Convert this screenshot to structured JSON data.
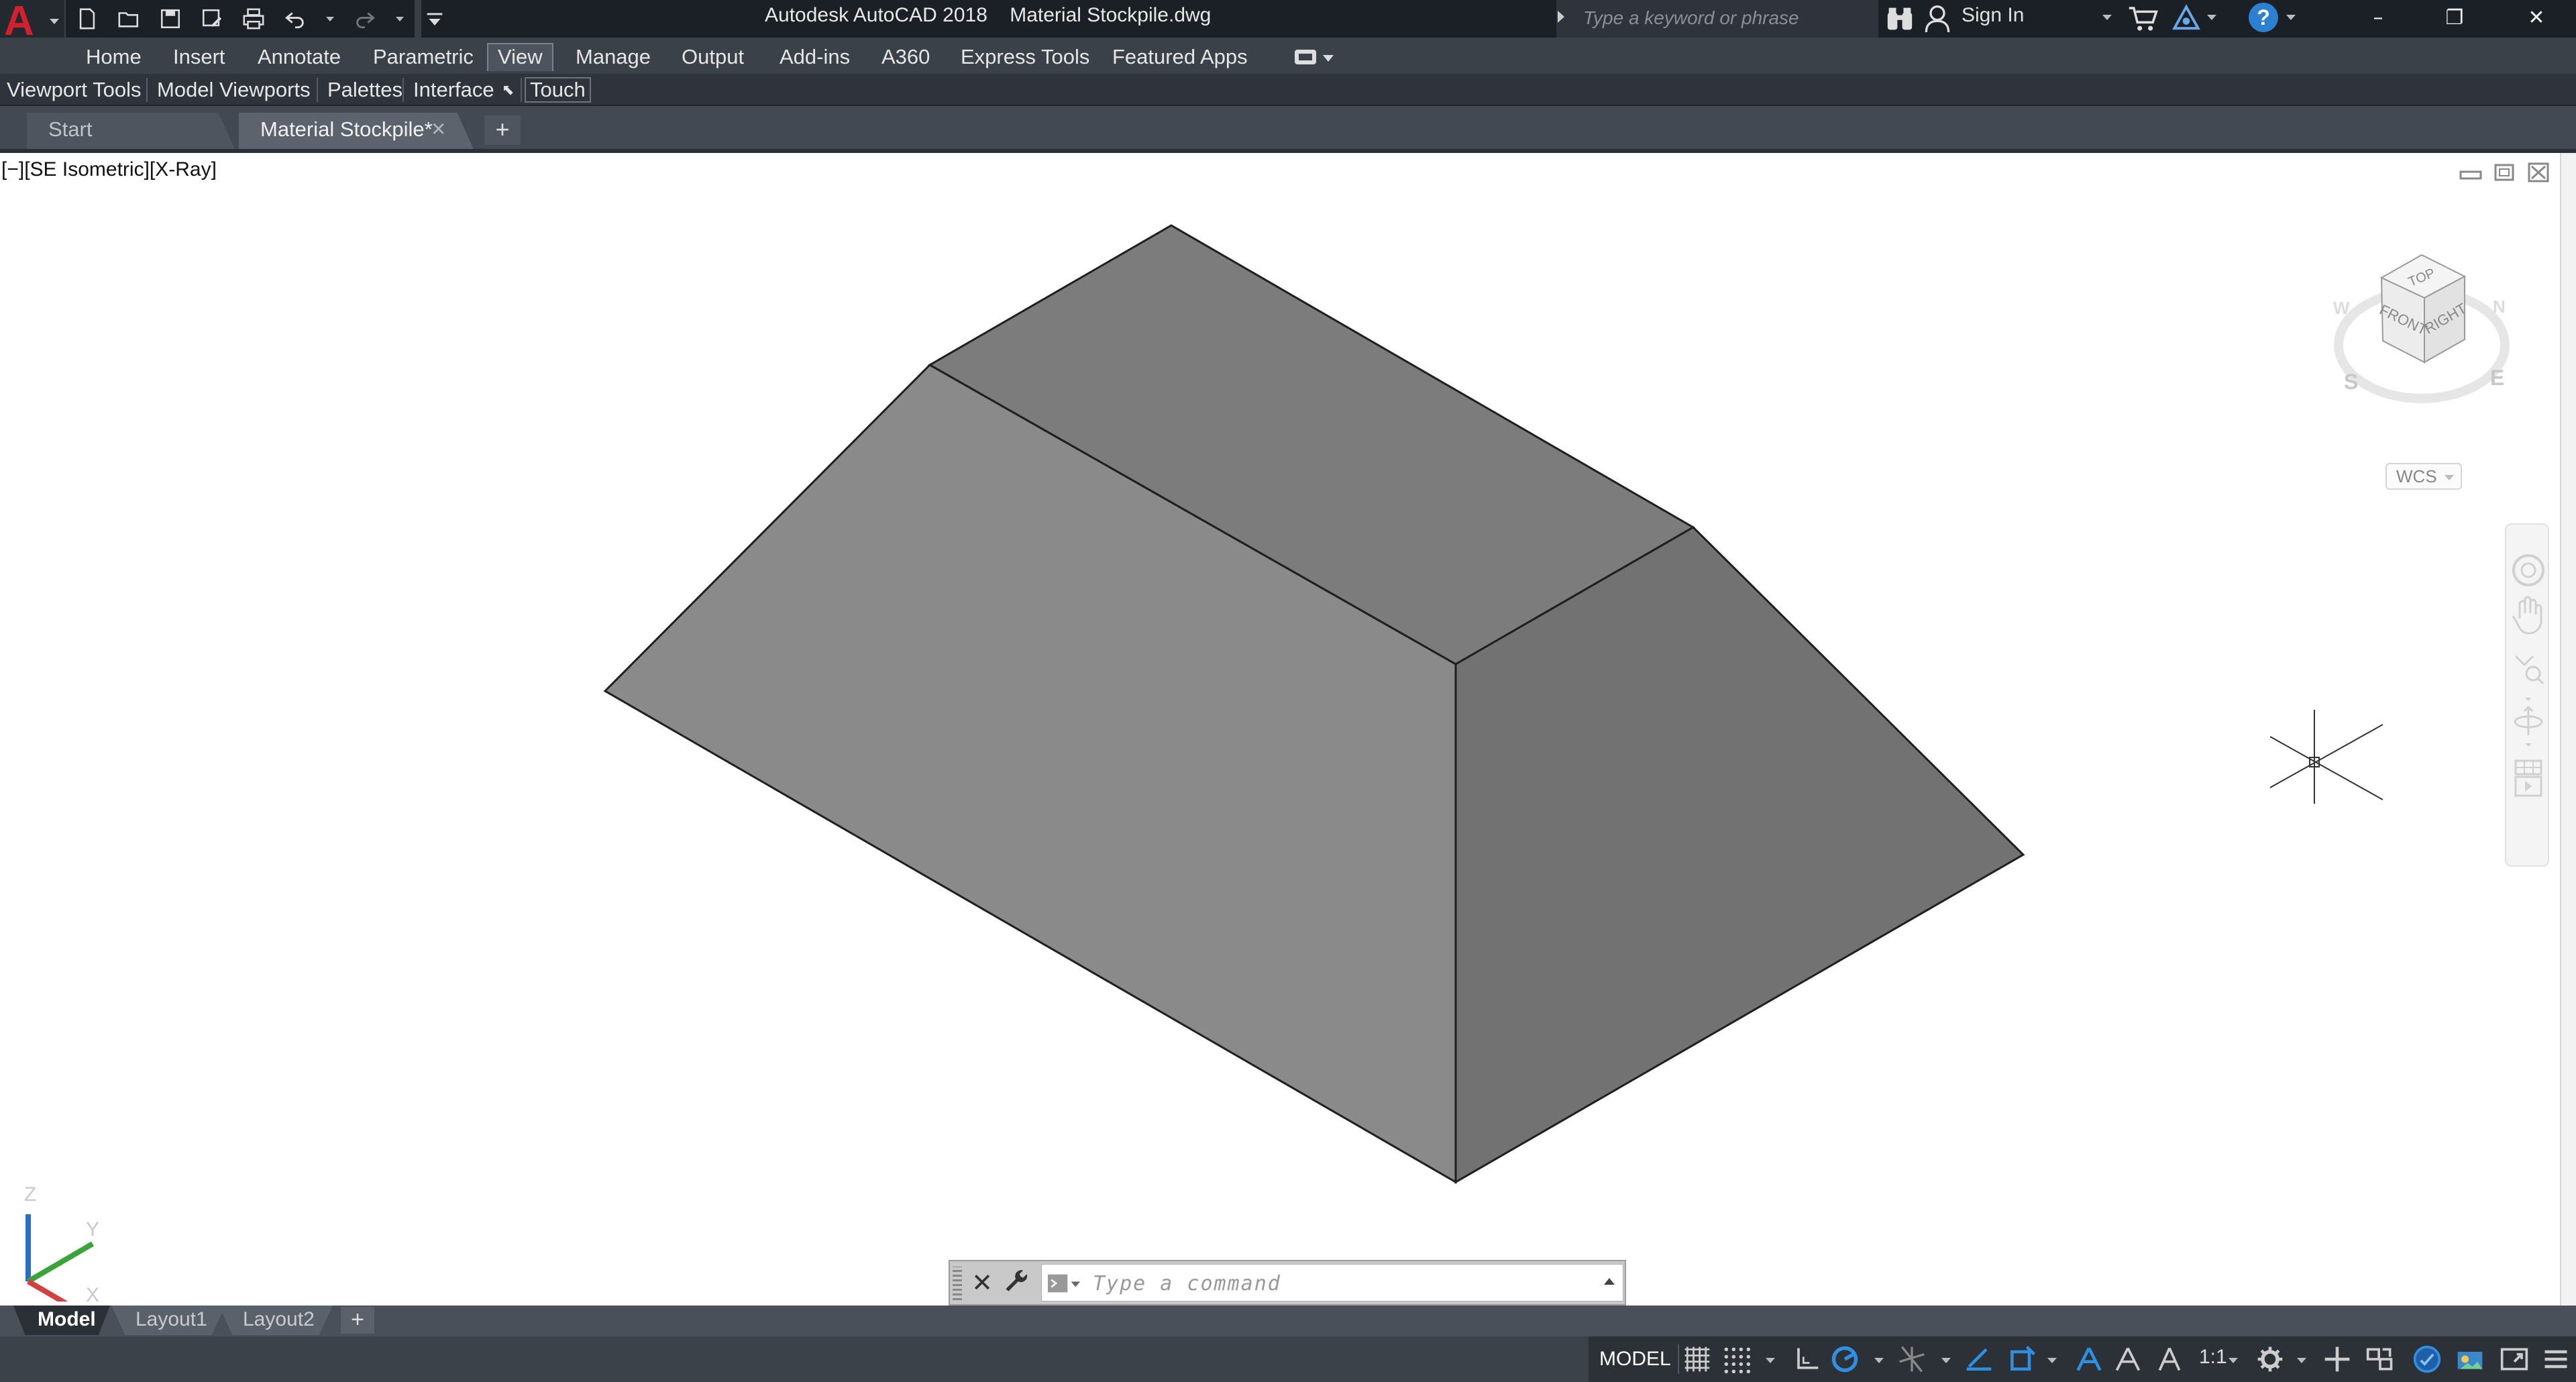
{
  "app": {
    "title": "Autodesk AutoCAD 2018    Material Stockpile.dwg",
    "logo_letter": "A"
  },
  "search": {
    "placeholder": "Type a keyword or phrase"
  },
  "account": {
    "sign_in": "Sign In"
  },
  "help": {
    "label": "?"
  },
  "window_controls": {
    "minimize": "–",
    "maximize": "❐",
    "close": "✕"
  },
  "ribbon": {
    "tabs": [
      {
        "label": "Home"
      },
      {
        "label": "Insert"
      },
      {
        "label": "Annotate"
      },
      {
        "label": "Parametric"
      },
      {
        "label": "View",
        "active": true
      },
      {
        "label": "Manage"
      },
      {
        "label": "Output"
      },
      {
        "label": "Add-ins"
      },
      {
        "label": "A360"
      },
      {
        "label": "Express Tools"
      },
      {
        "label": "Featured Apps"
      }
    ],
    "panels": [
      {
        "label": "Viewport Tools"
      },
      {
        "label": "Model Viewports"
      },
      {
        "label": "Palettes"
      },
      {
        "label": "Interface"
      },
      {
        "label": "Touch"
      }
    ]
  },
  "file_tabs": {
    "start": "Start",
    "current": "Material Stockpile*",
    "close": "✕",
    "new": "+"
  },
  "viewport": {
    "label": "[−][SE Isometric][X-Ray]",
    "face_colors": {
      "top": "#7c7c7c",
      "front": "#8a8a8a",
      "right": "#727272"
    }
  },
  "viewcube": {
    "faces": {
      "top": "TOP",
      "front": "FRONT",
      "right": "RIGHT"
    },
    "compass": {
      "s": "S",
      "e": "E",
      "w": "W",
      "n": "N"
    },
    "wcs": "WCS"
  },
  "ucs": {
    "x": "X",
    "y": "Y",
    "z": "Z"
  },
  "command_line": {
    "placeholder": "Type a command",
    "close": "✕"
  },
  "layout_tabs": {
    "tabs": [
      {
        "label": "Model",
        "active": true
      },
      {
        "label": "Layout1"
      },
      {
        "label": "Layout2"
      }
    ],
    "add": "+"
  },
  "status": {
    "model": "MODEL",
    "scale": "1:1",
    "accent": "#2f8fe0"
  }
}
